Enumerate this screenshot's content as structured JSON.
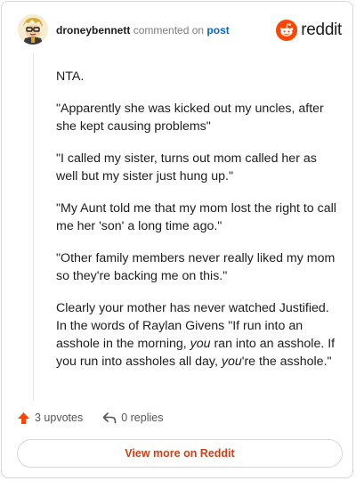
{
  "header": {
    "username": "droneybennett",
    "verb": "commented on",
    "link_text": "post",
    "logo_text": "reddit",
    "avatar_icon": "cartoon-avatar-icon",
    "logo_icon": "reddit-alien-icon"
  },
  "comment": {
    "p1": "NTA.",
    "p2": "\"Apparently she was kicked out my uncles, after she kept causing problems\"",
    "p3": "\"I called my sister, turns out mom called her as well but my sister just hung up.\"",
    "p4": "\"My Aunt told me that my mom lost the right to call me her 'son' a long time ago.\"",
    "p5": "\"Other family members never really liked my mom so they're backing me on this.\"",
    "p6_a": "Clearly your mother has never watched Justified. In the words of Raylan Givens \"If run into an asshole in the morning, ",
    "p6_b": "you",
    "p6_c": " ran into an asshole. If you run into assholes all day, ",
    "p6_d": "you",
    "p6_e": "'re the asshole.\""
  },
  "actions": {
    "upvotes": "3 upvotes",
    "replies": "0 replies",
    "upvote_icon": "upvote-arrow-icon",
    "reply_icon": "reply-arrow-icon"
  },
  "button": {
    "label": "View more on Reddit"
  },
  "colors": {
    "brand": "#ff4500",
    "upvote": "#ff4500",
    "link": "#0a66c2",
    "button_text": "#c4431a"
  }
}
